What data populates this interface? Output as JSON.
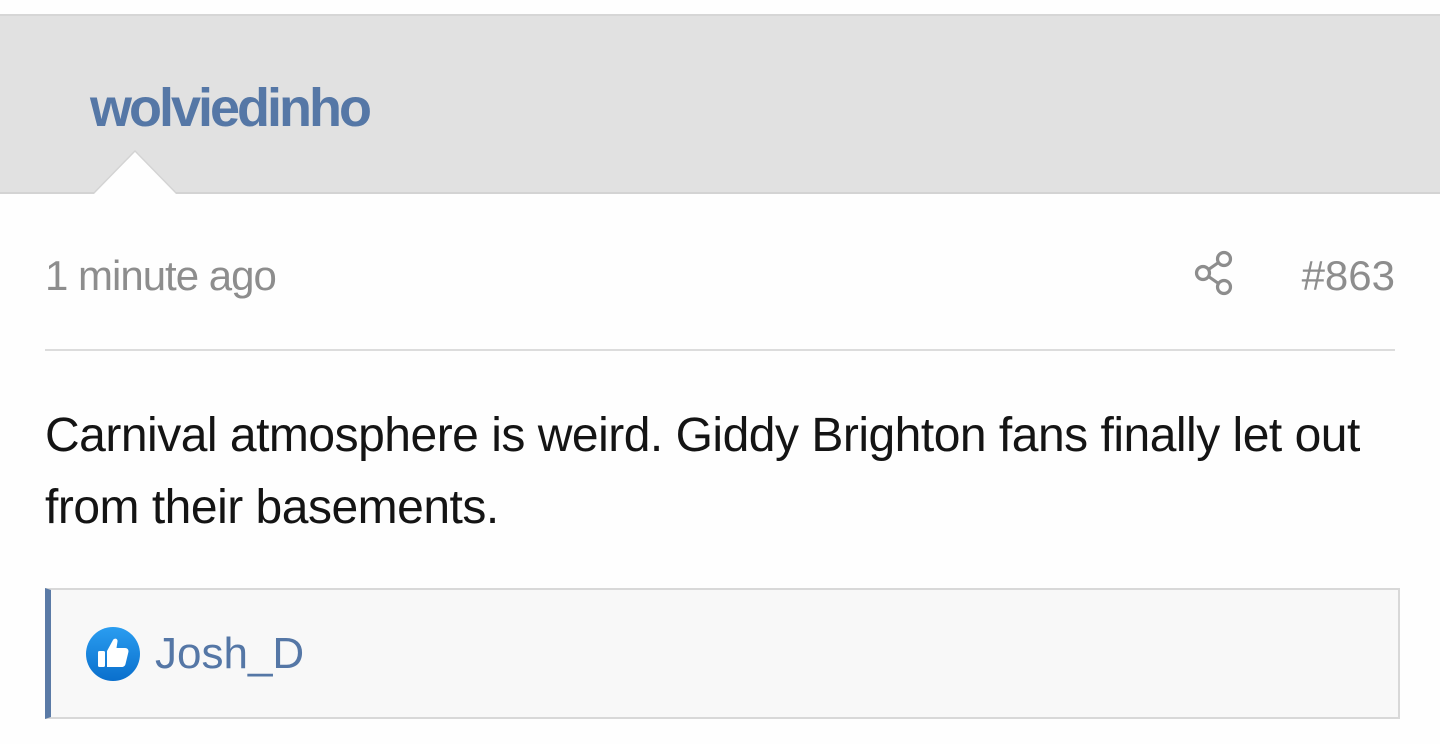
{
  "post": {
    "author": "wolviedinho",
    "timestamp": "1 minute ago",
    "number": "#863",
    "body": "Carnival atmosphere is weird. Giddy Brighton fans finally let out from their basements.",
    "share_icon": "share-icon"
  },
  "likes": {
    "icon": "thumbs-up-icon",
    "users": [
      "Josh_D"
    ]
  },
  "colors": {
    "link_blue": "#5577a6",
    "header_bg": "#e1e1e1",
    "meta_gray": "#8d8d8d",
    "like_badge": "#1a8ee0"
  }
}
